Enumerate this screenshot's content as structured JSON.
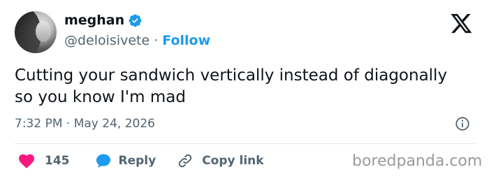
{
  "author": {
    "name": "meghan",
    "handle": "@deloisivete",
    "separator": "·",
    "follow_label": "Follow"
  },
  "tweet": {
    "text": "Cutting your sandwich vertically instead of diagonally so you know I'm mad",
    "timestamp": "7:32 PM · May 24, 2026"
  },
  "actions": {
    "like_count": "145",
    "reply_label": "Reply",
    "copy_link_label": "Copy link"
  },
  "watermark": "boredpanda.com",
  "icons": {
    "verified": "verified-badge-icon",
    "platform": "x-logo-icon",
    "info": "info-icon",
    "like": "heart-icon",
    "reply": "chat-bubble-icon",
    "copy": "link-icon"
  },
  "colors": {
    "accent": "#1d9bf0",
    "like": "#f91880",
    "secondary_text": "#536471",
    "primary_text": "#0f1419"
  }
}
